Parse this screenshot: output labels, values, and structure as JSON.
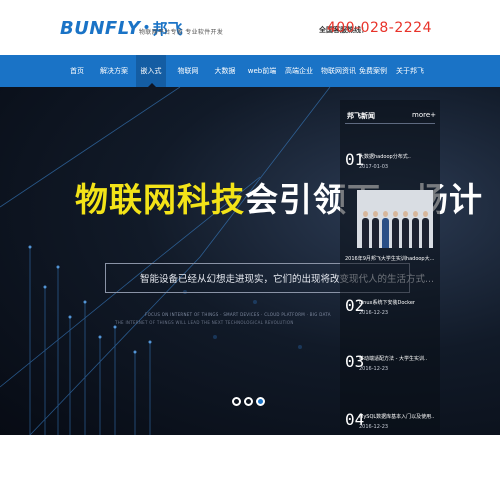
{
  "header": {
    "logo_text": "BUNFLY",
    "logo_dot": "•",
    "logo_cn": "邦飞",
    "logo_subtitle": "物联网平台专家  专业软件开发",
    "hotline_label": "全国客服热线：",
    "hotline_number": "400-028-2224",
    "brand_color": "#1a73c6",
    "hotline_color": "#e8332a"
  },
  "nav": {
    "items": [
      {
        "label": "首页"
      },
      {
        "label": "解决方案"
      },
      {
        "label": "嵌入式"
      },
      {
        "label": "物联网"
      },
      {
        "label": "大数据"
      },
      {
        "label": "web前端"
      },
      {
        "label": "高端企业"
      },
      {
        "label": "物联网资讯"
      },
      {
        "label": "免费案例"
      },
      {
        "label": "关于邦飞"
      }
    ],
    "active_index": 2
  },
  "banner": {
    "headline_yellow": "物联网科技",
    "headline_white": "会引领下一场计",
    "subtitle": "智能设备已经从幻想走进现实，它们的出现将改变现代人的生活方式...",
    "small_line_1": "FOCUS ON INTERNET OF THINGS · SMART DEVICES · CLOUD PLATFORM · BIG DATA",
    "small_line_2": "THE INTERNET OF THINGS WILL LEAD THE NEXT TECHNOLOGICAL REVOLUTION",
    "slides": 3,
    "active_slide": 2
  },
  "news_panel": {
    "title": "邦飞新闻",
    "more": "more+",
    "items": [
      {
        "num": "01",
        "title": "大数据hadoop分布式..",
        "date": "2017-01-03"
      },
      {
        "num": "02",
        "title": "Linux系统下安装Docker",
        "date": "2016-12-23"
      },
      {
        "num": "03",
        "title": "移动端适配方法 - 大学生实训..",
        "date": "2016-12-23"
      },
      {
        "num": "04",
        "title": "MySQL数据库基本入门以及使用..",
        "date": "2016-12-23"
      }
    ],
    "photo_caption": "2016年9月邦飞大学生实训hadoop大..."
  }
}
